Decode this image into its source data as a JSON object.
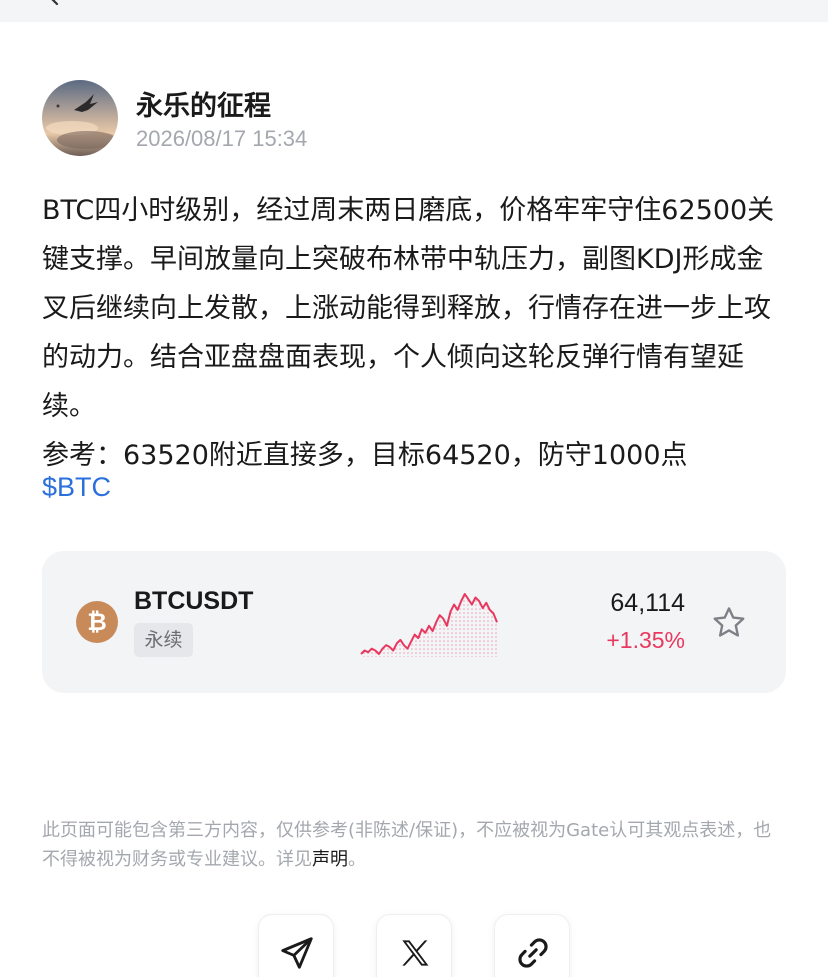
{
  "author": {
    "name": "永乐的征程",
    "time": "2026/08/17 15:34"
  },
  "post": {
    "paragraphs": [
      "BTC四小时级别，经过周末两日磨底，价格牢牢守住62500关键支撑。早间放量向上突破布林带中轨压力，副图KDJ形成金叉后继续向上发散，上涨动能得到释放，行情存在进一步上攻的动力。结合亚盘盘面表现，个人倾向这轮反弹行情有望延续。",
      "参考：63520附近直接多，目标64520，防守1000点"
    ],
    "cashtag": "$BTC"
  },
  "ticker": {
    "pair": "BTCUSDT",
    "contract_type": "永续",
    "price": "64,114",
    "change": "+1.35%",
    "coin_icon": "bitcoin-icon",
    "sparkline": [
      22,
      24,
      23,
      25,
      24,
      22,
      25,
      27,
      26,
      24,
      28,
      30,
      27,
      25,
      29,
      33,
      31,
      36,
      34,
      38,
      35,
      40,
      44,
      42,
      38,
      46,
      50,
      47,
      52,
      56,
      53,
      50,
      54,
      52,
      48,
      51,
      47,
      45,
      40
    ],
    "colors": {
      "up": "#e8385f",
      "logo": "#c98a5a"
    }
  },
  "disclaimer": {
    "text": "此页面可能包含第三方内容，仅供参考(非陈述/保证)，不应被视为Gate认可其观点表述，也不得被视为财务或专业建议。详见",
    "link": "声明",
    "end": "。"
  },
  "share": {
    "icons": [
      "send-icon",
      "x-logo-icon",
      "link-icon"
    ]
  }
}
